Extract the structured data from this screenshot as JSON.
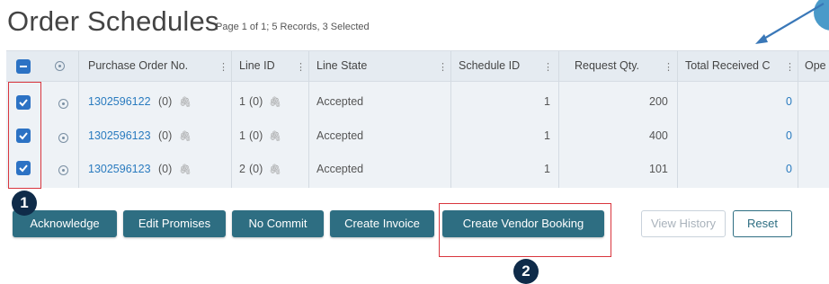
{
  "header": {
    "title": "Order Schedules",
    "subtitle": "Page 1 of 1; 5 Records, 3 Selected"
  },
  "table": {
    "columns": [
      "Purchase Order No.",
      "Line ID",
      "Line State",
      "Schedule ID",
      "Request Qty.",
      "Total Received C",
      "Ope"
    ],
    "rows": [
      {
        "po": "1302596122",
        "po_count": "(0)",
        "line_id": "1",
        "line_count": "(0)",
        "state": "Accepted",
        "schedule_id": "1",
        "qty": "200",
        "received": "0"
      },
      {
        "po": "1302596123",
        "po_count": "(0)",
        "line_id": "1",
        "line_count": "(0)",
        "state": "Accepted",
        "schedule_id": "1",
        "qty": "400",
        "received": "0"
      },
      {
        "po": "1302596123",
        "po_count": "(0)",
        "line_id": "2",
        "line_count": "(0)",
        "state": "Accepted",
        "schedule_id": "1",
        "qty": "101",
        "received": "0"
      }
    ]
  },
  "buttons": {
    "acknowledge": "Acknowledge",
    "edit_promises": "Edit Promises",
    "no_commit": "No Commit",
    "create_invoice": "Create Invoice",
    "create_vendor_booking": "Create Vendor Booking",
    "view_history": "View History",
    "reset": "Reset"
  },
  "annotations": {
    "badge_1": "1",
    "badge_2": "2"
  },
  "colors": {
    "accent_button": "#2e6e82",
    "checkbox": "#2c72c4",
    "annotation_red": "#d9363e",
    "badge": "#0f2b49",
    "link": "#2a7bbf"
  }
}
